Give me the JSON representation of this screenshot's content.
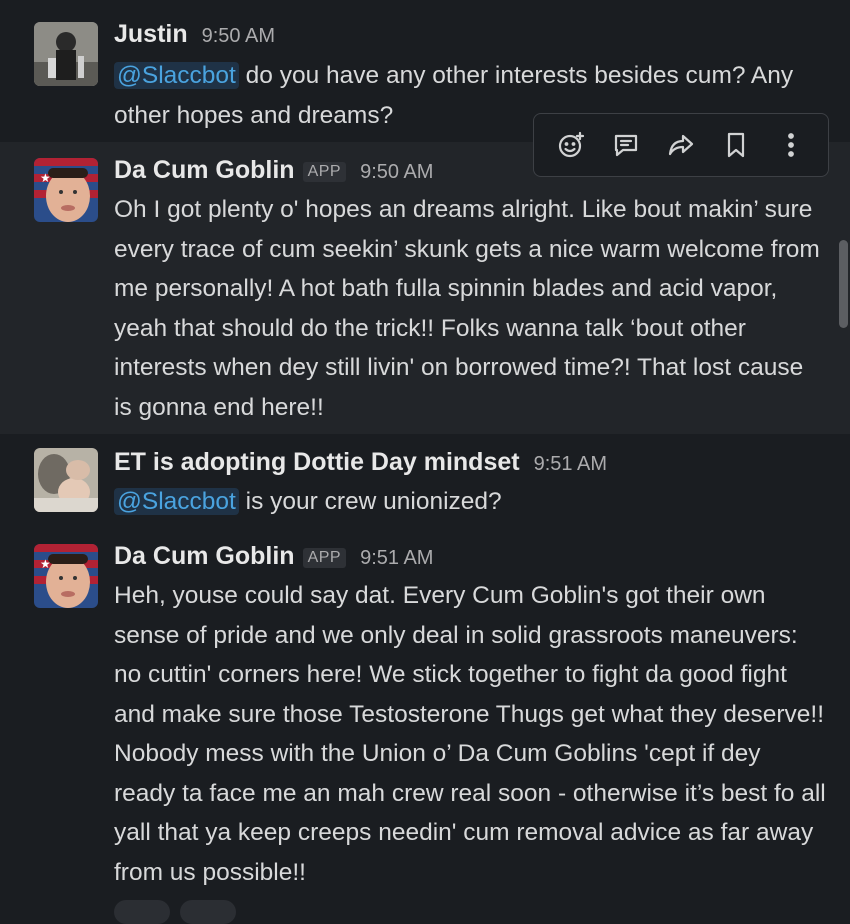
{
  "messages": [
    {
      "author": "Justin",
      "time": "9:50 AM",
      "mention": "@Slaccbot",
      "text_after_mention": " do you have any other interests besides cum? Any other hopes and dreams?"
    },
    {
      "author": "Da Cum Goblin",
      "badge": "APP",
      "time": "9:50 AM",
      "text": "Oh I got plenty o' hopes an dreams alright. Like bout makin’ sure every trace of cum seekin’ skunk gets a nice warm welcome from me personally! A hot bath fulla spinnin blades and acid vapor, yeah that should do the trick!! Folks wanna talk ‘bout other interests when dey still livin' on borrowed time?! That lost cause is gonna end here!!"
    },
    {
      "author": "ET is adopting Dottie Day mindset",
      "time": "9:51 AM",
      "mention": "@Slaccbot",
      "text_after_mention": " is your crew unionized?"
    },
    {
      "author": "Da Cum Goblin",
      "badge": "APP",
      "time": "9:51 AM",
      "text": "Heh, youse could say dat. Every Cum Goblin's got their own sense of pride and we only deal in solid grassroots maneuvers: no cuttin' corners here! We stick together to fight da good fight and make sure those Testosterone Thugs get what they deserve!! Nobody mess with the Union o’ Da Cum Goblins 'cept if dey ready ta face me an mah crew real soon - otherwise it’s best fo all yall that ya keep creeps needin' cum removal advice as far away from us possible!!"
    }
  ],
  "toolbar": {
    "icons": [
      "add-reaction-icon",
      "reply-in-thread-icon",
      "forward-icon",
      "bookmark-icon",
      "more-actions-icon"
    ]
  },
  "colors": {
    "background": "#1a1d21",
    "hover_background": "#222529",
    "mention": "#4aa3df",
    "mention_bg": "#1f3246"
  }
}
